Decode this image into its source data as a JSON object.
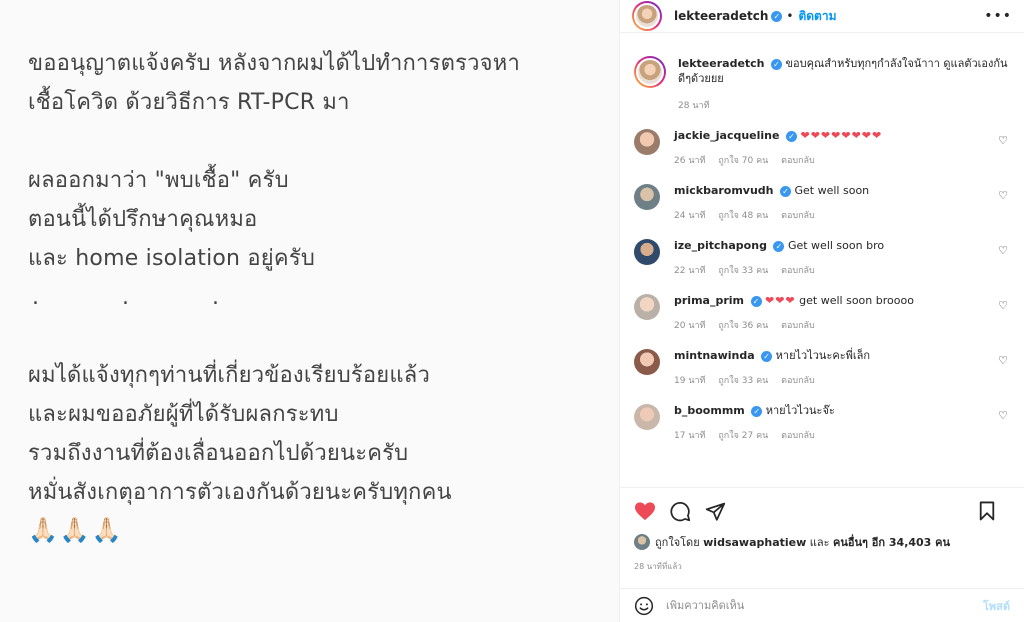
{
  "post": {
    "lines": [
      "ขออนุญาตแจ้งครับ หลังจากผมได้ไปทำการตรวจหา",
      "เชื้อโควิด ด้วยวิธีการ RT-PCR มา",
      "ผลออกมาว่า \"พบเชื้อ\" ครับ",
      "ตอนนี้ได้ปรึกษาคุณหมอ",
      "และ home isolation อยู่ครับ",
      ". . .",
      "ผมได้แจ้งทุกๆท่านที่เกี่ยวข้องเรียบร้อยแล้ว",
      "และผมขออภัยผู้ที่ได้รับผลกระทบ",
      "รวมถึงงานที่ต้องเลื่อนออกไปด้วยนะครับ",
      "หมั่นสังเกตุอาการตัวเองกันด้วยนะครับทุกคน",
      "🙏🏻🙏🏻🙏🏻"
    ]
  },
  "header": {
    "username": "lekteeradetch",
    "follow_label": "ติดตาม",
    "more_icon": "more-horizontal-icon"
  },
  "caption": {
    "username": "lekteeradetch",
    "text": "ขอบคุณสำหรับทุกๆกำลังใจน้าาา ดูแลตัวเองกันดีๆด้วยยย",
    "time": "28 นาที"
  },
  "comments": [
    {
      "username": "jackie_jacqueline",
      "text": "",
      "hearts": "❤❤❤❤❤❤❤❤",
      "time": "26 นาที",
      "likes": "ถูกใจ 70 คน",
      "reply": "ตอบกลับ"
    },
    {
      "username": "mickbaromvudh",
      "text": "Get well soon",
      "hearts": "",
      "time": "24 นาที",
      "likes": "ถูกใจ 48 คน",
      "reply": "ตอบกลับ"
    },
    {
      "username": "ize_pitchapong",
      "text": "Get well soon bro",
      "hearts": "",
      "time": "22 นาที",
      "likes": "ถูกใจ 33 คน",
      "reply": "ตอบกลับ"
    },
    {
      "username": "prima_prim",
      "text": "get well soon broooo",
      "hearts": "❤❤❤",
      "time": "20 นาที",
      "likes": "ถูกใจ 36 คน",
      "reply": "ตอบกลับ"
    },
    {
      "username": "mintnawinda",
      "text": "หายไวไวนะคะพี่เล็ก",
      "hearts": "",
      "time": "19 นาที",
      "likes": "ถูกใจ 33 คน",
      "reply": "ตอบกลับ"
    },
    {
      "username": "b_boommm",
      "text": "หายไวไวนะจ๊ะ",
      "hearts": "",
      "time": "17 นาที",
      "likes": "ถูกใจ 27 คน",
      "reply": "ตอบกลับ"
    }
  ],
  "actions": {
    "liked_by_prefix": "ถูกใจโดย",
    "liked_by_user": "widsawaphatiew",
    "liked_by_and": "และ",
    "liked_by_others": "คนอื่นๆ อีก 34,403 คน",
    "posted_ago": "28 นาทีที่แล้ว"
  },
  "add_comment": {
    "placeholder": "เพิ่มความคิดเห็น",
    "post_label": "โพสต์"
  },
  "colors": {
    "like_red": "#ed4956",
    "link_blue": "#0095f6",
    "muted": "#8e8e8e"
  }
}
